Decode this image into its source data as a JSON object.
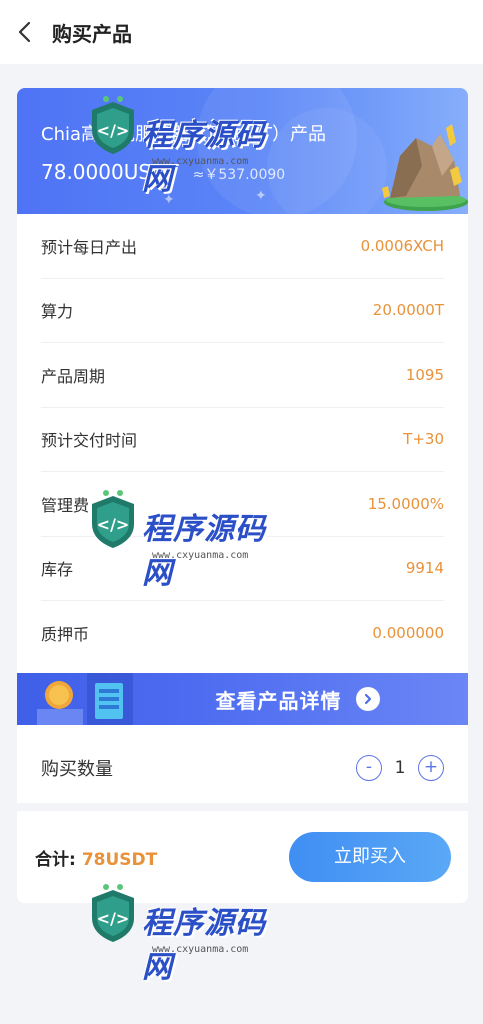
{
  "header": {
    "title": "购买产品"
  },
  "product": {
    "name": "Chia高性能服务器（算力-1T）产品",
    "price_usdt": "78.0000USDT",
    "price_cny": "≈￥537.0090"
  },
  "info_rows": [
    {
      "label": "预计每日产出",
      "value": "0.0006XCH"
    },
    {
      "label": "算力",
      "value": "20.0000T"
    },
    {
      "label": "产品周期",
      "value": "1095"
    },
    {
      "label": "预计交付时间",
      "value": "T+30"
    },
    {
      "label": "管理费",
      "value": "15.0000%"
    },
    {
      "label": "库存",
      "value": "9914"
    },
    {
      "label": "质押币",
      "value": "0.000000"
    }
  ],
  "detail_button": {
    "label": "查看产品详情"
  },
  "quantity": {
    "label": "购买数量",
    "value": "1",
    "minus": "-",
    "plus": "+"
  },
  "total": {
    "label": "合计:",
    "value": "78USDT"
  },
  "buy_button": {
    "label": "立即买入"
  },
  "watermark": {
    "text": "程序源码网",
    "url": "www.cxyuanma.com"
  },
  "colors": {
    "accent_orange": "#e8923a",
    "primary_blue": "#4f73f5",
    "button_blue": "#3f8ef3"
  }
}
